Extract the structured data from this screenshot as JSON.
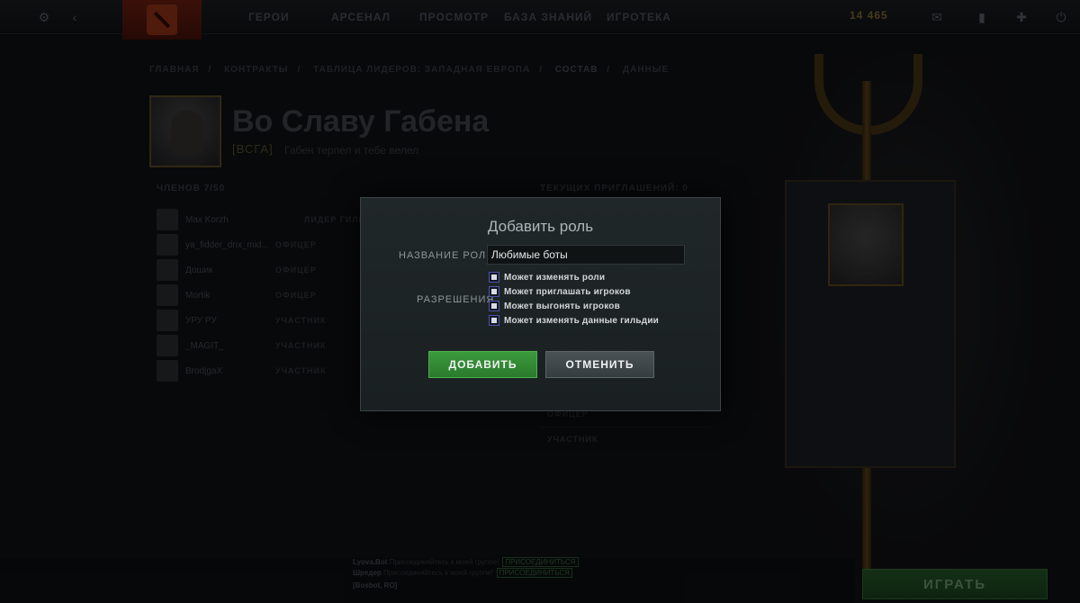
{
  "topnav": {
    "items": [
      "ГЕРОИ",
      "АРСЕНАЛ",
      "ПРОСМОТР",
      "БАЗА ЗНАНИЙ",
      "ИГРОТЕКА"
    ],
    "gold": "14 465"
  },
  "breadcrumb": [
    "ГЛАВНАЯ",
    "КОНТРАКТЫ",
    "ТАБЛИЦА ЛИДЕРОВ: ЗАПАДНАЯ ЕВРОПА",
    "СОСТАВ",
    "ДАННЫЕ"
  ],
  "guild": {
    "name": "Во Славу Габена",
    "tag": "[ВСГА]",
    "motto": "Габен терпел и тебе велел"
  },
  "members": {
    "header": "ЧЛЕНОВ 7/50",
    "rows": [
      {
        "name": "Max Korzh",
        "role": "ЛИДЕР ГИЛЬДИИ"
      },
      {
        "name": "ya_fidder_dnx_mid...",
        "role": "ОФИЦЕР"
      },
      {
        "name": "Дошик",
        "role": "ОФИЦЕР"
      },
      {
        "name": "Mortik",
        "role": "ОФИЦЕР"
      },
      {
        "name": "УРУ РУ",
        "role": "УЧАСТНИК"
      },
      {
        "name": "_MAGIT_",
        "role": "УЧАСТНИК"
      },
      {
        "name": "BrodjgaX",
        "role": "УЧАСТНИК"
      }
    ]
  },
  "invites": {
    "header": "ТЕКУЩИХ ПРИГЛАШЕНИЙ: 0",
    "roles": [
      "ОФИЦЕР",
      "УЧАСТНИК"
    ]
  },
  "chat": {
    "lines": [
      {
        "user": "Lyova.Bot",
        "text": "Присоединяйтесь к моей группе!",
        "link": "ПРИСОЕДИНИТЬСЯ"
      },
      {
        "user": "Шредер",
        "text": "Присоединяйтесь к моей группе!",
        "link": "ПРИСОЕДИНИТЬСЯ"
      },
      {
        "user": "[Bosbot, RO]",
        "text": "",
        "link": ""
      }
    ]
  },
  "play_button": "ИГРАТЬ",
  "dialog": {
    "title": "Добавить роль",
    "role_name_label": "НАЗВАНИЕ РОЛИ",
    "role_name_value": "Любимые боты",
    "permissions_label": "РАЗРЕШЕНИЯ",
    "permissions": [
      {
        "label": "Может изменять роли",
        "checked": false
      },
      {
        "label": "Может приглашать игроков",
        "checked": false
      },
      {
        "label": "Может выгонять игроков",
        "checked": false
      },
      {
        "label": "Может изменять данные гильдии",
        "checked": false
      }
    ],
    "add_button": "ДОБАВИТЬ",
    "cancel_button": "ОТМЕНИТЬ"
  },
  "colors": {
    "accent_green": "#3c9a3c",
    "checkbox_border": "#4a54a8",
    "dialog_bg": "#202729"
  }
}
